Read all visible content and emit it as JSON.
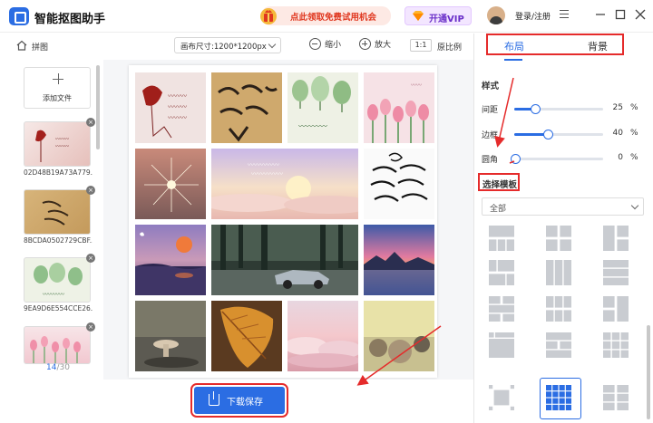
{
  "app": {
    "title": "智能抠图助手"
  },
  "header": {
    "promo": "点此领取免费试用机会",
    "vip": "开通VIP",
    "login": "登录/注册"
  },
  "toolbar": {
    "breadcrumb": "拼图",
    "canvas_size": "画布尺寸:1200*1200px",
    "zoom_out": "缩小",
    "zoom_in": "放大",
    "ratio": "1:1",
    "original_ratio": "原比例"
  },
  "files": {
    "add_label": "添加文件",
    "items": [
      {
        "name": "02D48B19A73A779..."
      },
      {
        "name": "8BCDA0502729CBF..."
      },
      {
        "name": "9EA9D6E554CCE26..."
      }
    ],
    "counter_current": "14",
    "counter_total": "/30"
  },
  "collage": {
    "grid": "4x4 template, 14 images",
    "tiles": [
      {
        "desc": "red flower sketch"
      },
      {
        "desc": "handwriting on paper"
      },
      {
        "desc": "green trees drawing"
      },
      {
        "desc": "pink tulips"
      },
      {
        "desc": "firework sparkle"
      },
      {
        "desc": "sunset clouds"
      },
      {
        "desc": "handwriting black ink"
      },
      {
        "desc": "purple sky moon"
      },
      {
        "desc": "car in forest"
      },
      {
        "desc": "sunset over water"
      },
      {
        "desc": "mushroom"
      },
      {
        "desc": "autumn leaf"
      },
      {
        "desc": "pink clouds"
      },
      {
        "desc": "planets"
      }
    ]
  },
  "bottom": {
    "download": "下载保存"
  },
  "sidebar": {
    "tabs": [
      {
        "label": "布局"
      },
      {
        "label": "背景"
      }
    ],
    "style_heading": "样式",
    "sliders": [
      {
        "label": "间距",
        "value": "25",
        "unit": "%",
        "fraction": 0.25
      },
      {
        "label": "边框",
        "value": "40",
        "unit": "%",
        "fraction": 0.4
      },
      {
        "label": "圆角",
        "value": "0",
        "unit": "%",
        "fraction": 0.0
      }
    ],
    "template_heading": "选择模板",
    "filter": "全部"
  },
  "colors": {
    "accent": "#2b6de3",
    "highlight": "#e52b2b"
  }
}
